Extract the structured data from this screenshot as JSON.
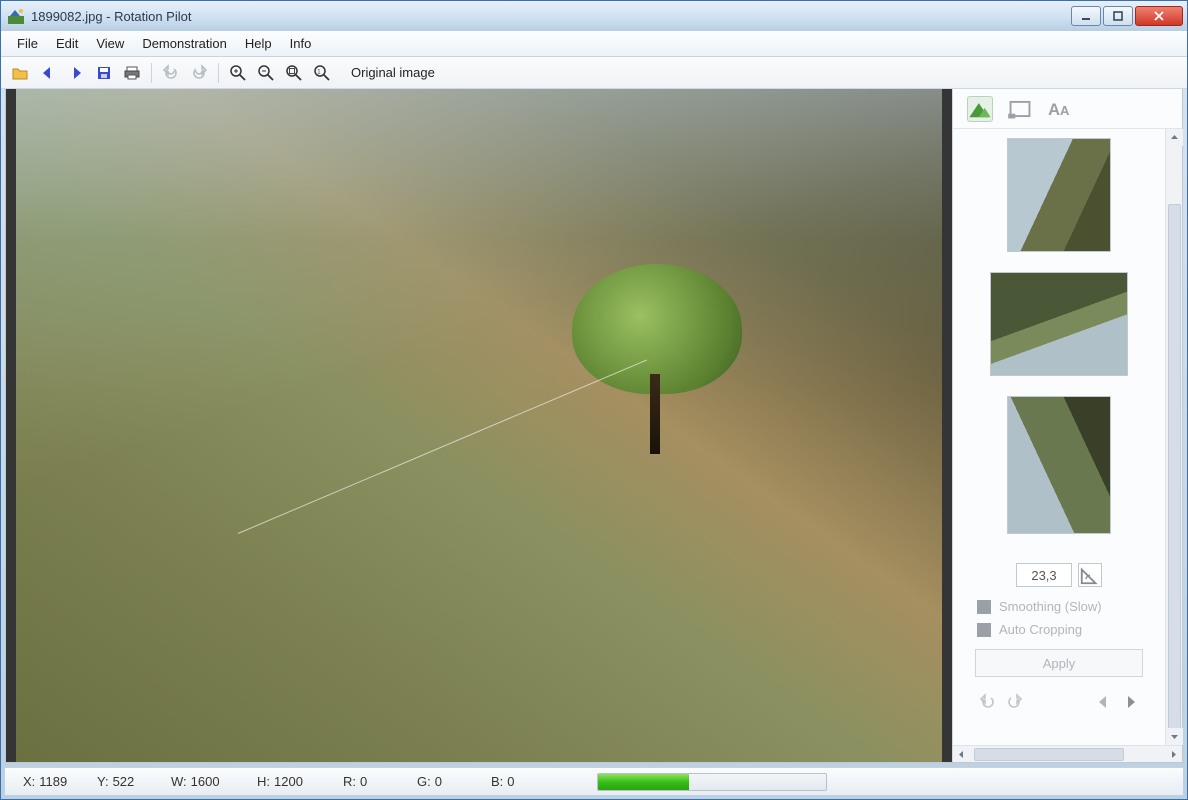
{
  "window": {
    "title": "1899082.jpg - Rotation Pilot"
  },
  "menu": {
    "file": "File",
    "edit": "Edit",
    "view": "View",
    "demonstration": "Demonstration",
    "help": "Help",
    "info": "Info"
  },
  "toolbar": {
    "zoom_mode_label": "Original image"
  },
  "sidepanel": {
    "angle_value": "23,3",
    "smoothing_label": "Smoothing (Slow)",
    "autocrop_label": "Auto Cropping",
    "apply_label": "Apply"
  },
  "status": {
    "x_label": "X:",
    "x_val": "1189",
    "y_label": "Y:",
    "y_val": "522",
    "w_label": "W:",
    "w_val": "1600",
    "h_label": "H:",
    "h_val": "1200",
    "r_label": "R:",
    "r_val": "0",
    "g_label": "G:",
    "g_val": "0",
    "b_label": "B:",
    "b_val": "0",
    "progress_percent": 40
  },
  "colors": {
    "accent_green": "#36c018",
    "close_red": "#d03828"
  }
}
